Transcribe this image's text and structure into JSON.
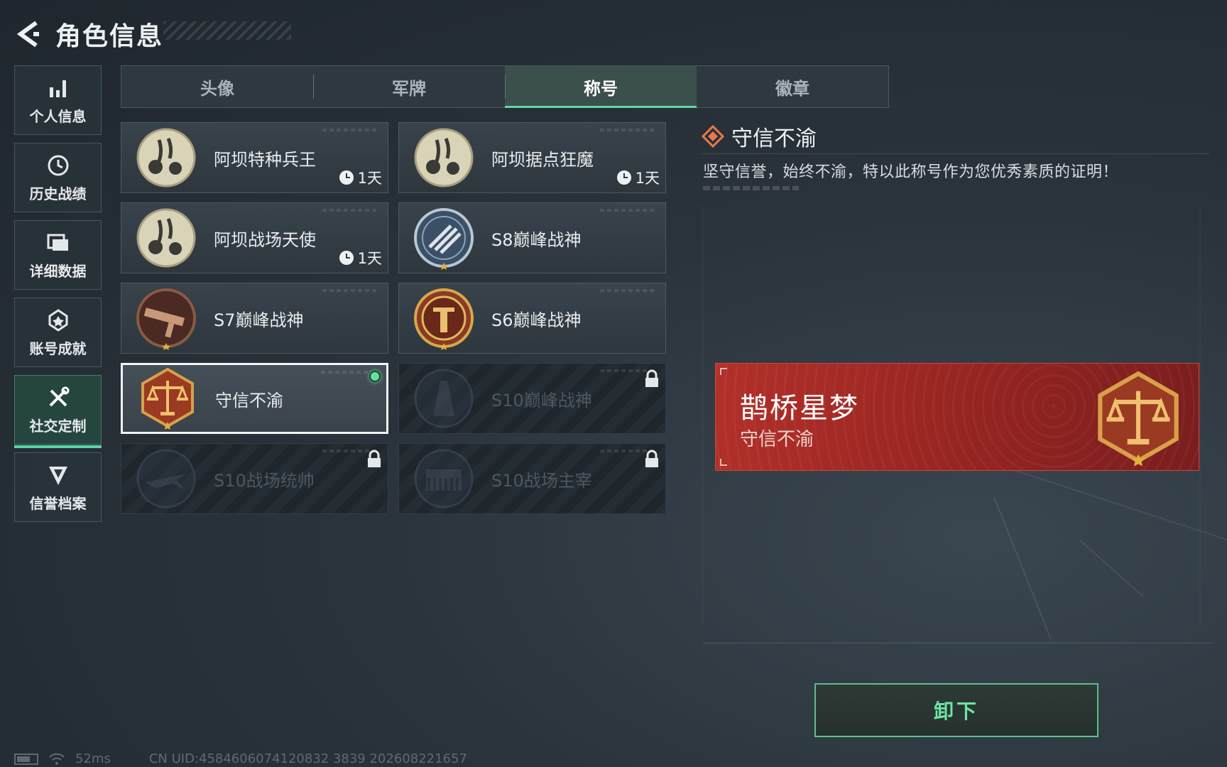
{
  "header": {
    "title": "角色信息"
  },
  "sidebar": {
    "items": [
      {
        "label": "个人信息",
        "icon": "bar-chart-icon",
        "active": false
      },
      {
        "label": "历史战绩",
        "icon": "history-icon",
        "active": false
      },
      {
        "label": "详细数据",
        "icon": "folder-icon",
        "active": false
      },
      {
        "label": "账号成就",
        "icon": "medal-icon",
        "active": false
      },
      {
        "label": "社交定制",
        "icon": "tools-icon",
        "active": true
      },
      {
        "label": "信誉档案",
        "icon": "shield-icon",
        "active": false
      }
    ]
  },
  "tabs": [
    {
      "label": "头像",
      "active": false
    },
    {
      "label": "军牌",
      "active": false
    },
    {
      "label": "称号",
      "active": true
    },
    {
      "label": "徽章",
      "active": false
    }
  ],
  "titles": [
    {
      "name": "阿坝特种兵王",
      "timer": "1天",
      "badge": "panda-badge-icon",
      "state": "owned"
    },
    {
      "name": "阿坝据点狂魔",
      "timer": "1天",
      "badge": "panda-badge-icon",
      "state": "owned"
    },
    {
      "name": "阿坝战场天使",
      "timer": "1天",
      "badge": "panda-badge-icon",
      "state": "owned"
    },
    {
      "name": "S8巅峰战神",
      "badge": "s8-emblem-icon",
      "state": "owned"
    },
    {
      "name": "S7巅峰战神",
      "badge": "s7-rifle-emblem-icon",
      "state": "owned"
    },
    {
      "name": "S6巅峰战神",
      "badge": "s6-emblem-icon",
      "state": "owned"
    },
    {
      "name": "守信不渝",
      "badge": "scales-emblem-icon",
      "state": "equipped"
    },
    {
      "name": "S10巅峰战神",
      "badge": "s10-tower-emblem-icon",
      "state": "locked"
    },
    {
      "name": "S10战场统帅",
      "badge": "s10-jet-emblem-icon",
      "state": "locked"
    },
    {
      "name": "S10战场主宰",
      "badge": "s10-colosseum-emblem-icon",
      "state": "locked"
    }
  ],
  "detail": {
    "title": "守信不渝",
    "description": "坚守信誉，始终不渝，特以此称号作为您优秀素质的证明！",
    "banner": {
      "player_name": "鹊桥星梦",
      "title": "守信不渝",
      "color": "#b3302a"
    },
    "action_label": "卸下"
  },
  "footer": {
    "ping": "52ms",
    "uid": "CN UID:4584606074120832 3839 202608221657"
  },
  "colors": {
    "accent": "#5fd8a4",
    "equipped": "#5fe39b",
    "banner": "#b3302a"
  }
}
